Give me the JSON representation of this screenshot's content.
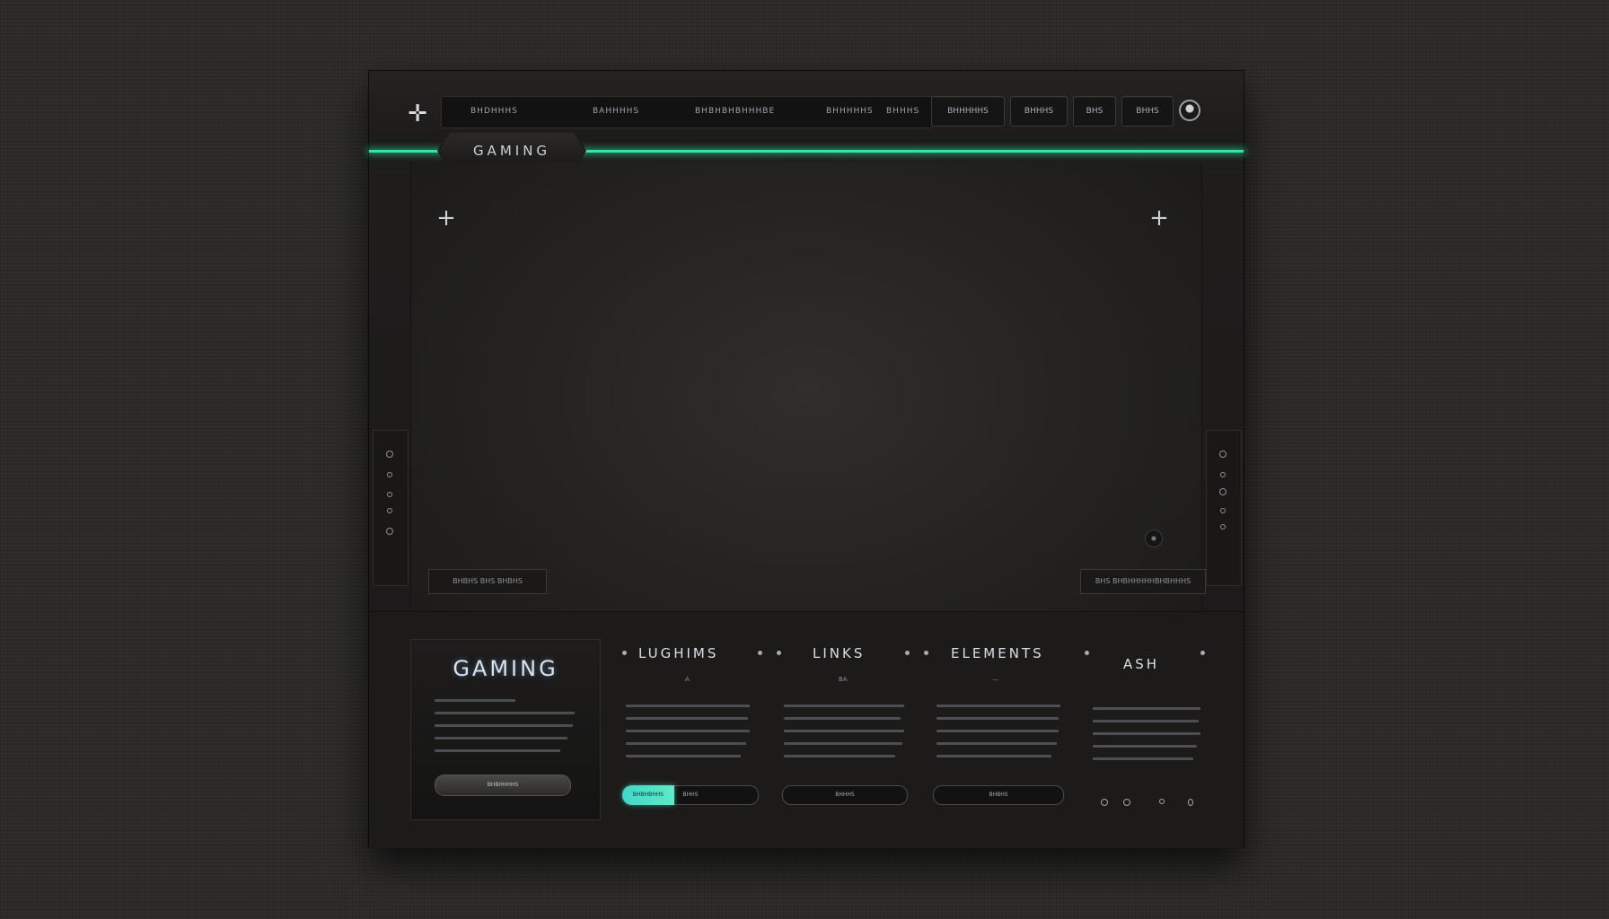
{
  "topbar": {
    "nav_items": [
      "BHDHHHS",
      "BAHHHHS",
      "BHBHBHBHHHBE",
      "BHHHHHS",
      "BHHHS"
    ],
    "buttons": [
      "BHHHHHS",
      "BHHHS",
      "BHS",
      "BHHS"
    ],
    "tab_label": "GAMING"
  },
  "viewport": {
    "left_label": "BHBHS BHS BHBHS",
    "right_label": "BHS BHBHHHHHBHBHHHS"
  },
  "bottom": {
    "promo_title": "GAMING",
    "promo_button": "BHBHHHHS",
    "headers": [
      "LUGHIMS",
      "LINKS",
      "ELEMENTS",
      "ASH"
    ],
    "col_subs": [
      "A",
      "BA",
      "—"
    ],
    "col_buttons": [
      "BHHS",
      "BHHHS",
      "BHBHS"
    ],
    "accent_button": "BHBHBHHS"
  },
  "colors": {
    "accent": "#2ee6a6",
    "accent_button": "#3fd7c9"
  }
}
